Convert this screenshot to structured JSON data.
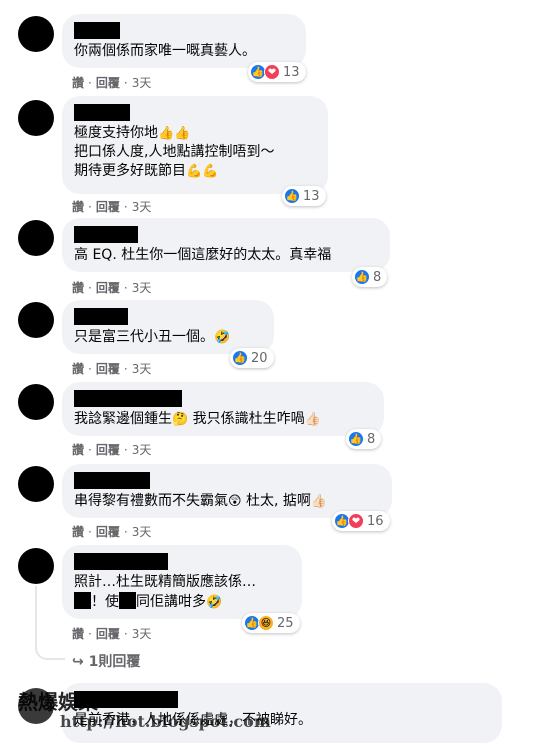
{
  "comments": [
    {
      "id": "c1",
      "lines": [
        "你兩個係而家唯一嘅真藝人。"
      ],
      "reaction_count": "13",
      "reactions": [
        "like",
        "love"
      ],
      "actions": {
        "like": "讚",
        "reply": "回覆",
        "time": "3天"
      }
    },
    {
      "id": "c2",
      "lines": [
        "極度支持你地",
        "把口係人度,人地點講控制唔到～",
        "期待更多好既節目"
      ],
      "line_emojis": [
        "👍👍",
        "",
        "💪💪"
      ],
      "reaction_count": "13",
      "reactions": [
        "like"
      ],
      "actions": {
        "like": "讚",
        "reply": "回覆",
        "time": "3天"
      }
    },
    {
      "id": "c3",
      "lines": [
        "高 EQ. 杜生你一個這麼好的太太。真幸福"
      ],
      "reaction_count": "8",
      "reactions": [
        "like"
      ],
      "actions": {
        "like": "讚",
        "reply": "回覆",
        "time": "3天"
      }
    },
    {
      "id": "c4",
      "lines": [
        "只是富三代小丑一個。"
      ],
      "line_emojis": [
        "🤣"
      ],
      "reaction_count": "20",
      "reactions": [
        "like"
      ],
      "actions": {
        "like": "讚",
        "reply": "回覆",
        "time": "3天"
      }
    },
    {
      "id": "c5",
      "lines": [
        "我諗緊邊個鍾生",
        " 我只係識杜生咋喎"
      ],
      "line_emojis": [
        "🤔",
        "👍🏻"
      ],
      "reaction_count": "8",
      "reactions": [
        "like"
      ],
      "actions": {
        "like": "讚",
        "reply": "回覆",
        "time": "3天"
      }
    },
    {
      "id": "c6",
      "lines": [
        "串得黎有禮數而不失霸氣",
        " 杜太, 掂啊"
      ],
      "line_emojis": [
        "😲",
        "👍🏻"
      ],
      "reaction_count": "16",
      "reactions": [
        "like",
        "love"
      ],
      "actions": {
        "like": "讚",
        "reply": "回覆",
        "time": "3天"
      }
    },
    {
      "id": "c7",
      "lines": [
        "照計…杜生既精簡版應該係…",
        "！使",
        "同佢講咁多"
      ],
      "line_emojis": [
        "🤣"
      ],
      "reaction_count": "25",
      "reactions": [
        "like",
        "haha"
      ],
      "actions": {
        "like": "讚",
        "reply": "回覆",
        "time": "3天"
      }
    }
  ],
  "reply_link": {
    "arrow": "↪",
    "label": "1則回覆"
  },
  "partial_comment": {
    "text": "是前香港，人地係係處處，不被睇好。"
  },
  "watermark": {
    "title": "熱爆娛樂",
    "url": "http://hot.blogspot.com"
  },
  "icons": {
    "like": "👍",
    "love": "❤",
    "haha": "😆"
  },
  "colors": {
    "like": "#1877f2",
    "love": "#f33e58",
    "haha": "#f7b125",
    "bubble": "#f0f2f5",
    "meta": "#65676b"
  }
}
